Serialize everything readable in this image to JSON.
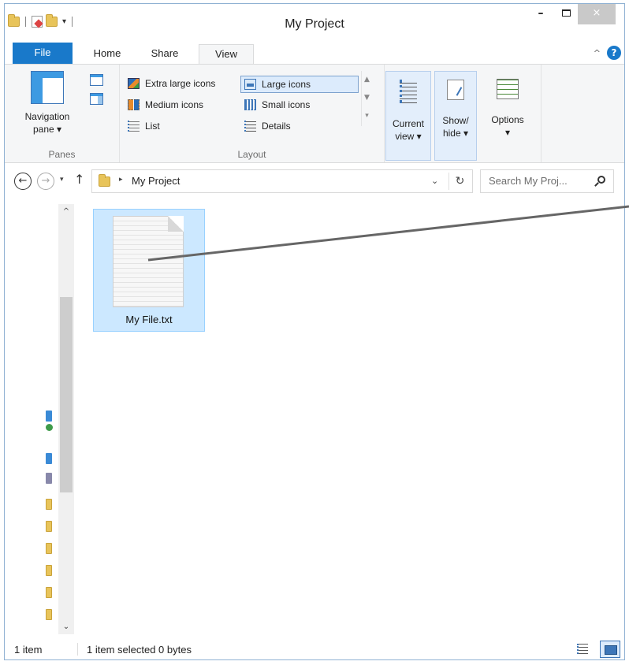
{
  "window": {
    "title": "My Project",
    "controls": {
      "minimize": "–",
      "maximize": "□",
      "close": "×"
    }
  },
  "quick_access": {
    "dropdown": "▾"
  },
  "tabs": [
    {
      "label": "File"
    },
    {
      "label": "Home"
    },
    {
      "label": "Share"
    },
    {
      "label": "View"
    }
  ],
  "help": {
    "collapse": "^",
    "icon": "?"
  },
  "ribbon": {
    "panes": {
      "navigation_pane": "Navigation",
      "navigation_pane_2": "pane ▾",
      "label": "Panes"
    },
    "layout": {
      "items": [
        {
          "label": "Extra large icons"
        },
        {
          "label": "Large icons"
        },
        {
          "label": "Medium icons"
        },
        {
          "label": "Small icons"
        },
        {
          "label": "List"
        },
        {
          "label": "Details"
        }
      ],
      "label": "Layout"
    },
    "current_view": {
      "line1": "Current",
      "line2": "view ▾"
    },
    "show_hide": {
      "line1": "Show/",
      "line2": "hide ▾"
    },
    "options": {
      "line1": "Options",
      "line2": "▾"
    }
  },
  "address": {
    "back": "←",
    "forward": "→",
    "recent": "▾",
    "up": "↑",
    "crumb_sep": "▸",
    "path": "My Project",
    "dropdown": "⌄",
    "refresh": "↻",
    "search_placeholder": "Search My Proj..."
  },
  "nav_scroll": {
    "up": "^",
    "down": "⌄"
  },
  "files": [
    {
      "name": "My File.txt",
      "selected": true
    }
  ],
  "status": {
    "count": "1 item",
    "selection": "1 item selected  0 bytes"
  }
}
